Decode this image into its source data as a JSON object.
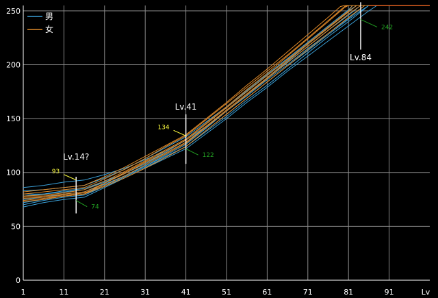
{
  "chart_data": {
    "type": "line",
    "xlabel": "Lv",
    "xlim": [
      1,
      101
    ],
    "ylim": [
      0,
      255
    ],
    "x_ticks": [
      1,
      11,
      21,
      31,
      41,
      51,
      61,
      71,
      81,
      91
    ],
    "y_ticks": [
      0,
      50,
      100,
      150,
      200,
      250
    ],
    "grid": true,
    "legend_position": "top-left",
    "colors": {
      "male": "#3aa0d8",
      "female": "#e08a2a",
      "cap": "#e06020",
      "grid": "#8a8a8a",
      "axis": "#ffffff",
      "green": "#22a022",
      "yellow": "#ffff40"
    },
    "legend": [
      {
        "label": "男",
        "color": "#3aa0d8"
      },
      {
        "label": "女",
        "color": "#e08a2a"
      }
    ],
    "series": [
      {
        "group": "male",
        "values": [
          [
            1,
            80
          ],
          [
            6,
            80
          ],
          [
            11,
            83
          ],
          [
            16,
            85
          ],
          [
            21,
            92
          ],
          [
            26,
            99
          ],
          [
            31,
            108
          ],
          [
            36,
            118
          ],
          [
            41,
            128
          ],
          [
            46,
            142
          ],
          [
            51,
            157
          ],
          [
            56,
            172
          ],
          [
            61,
            187
          ],
          [
            66,
            202
          ],
          [
            71,
            217
          ],
          [
            76,
            232
          ],
          [
            81,
            246
          ],
          [
            84,
            255
          ],
          [
            101,
            255
          ]
        ]
      },
      {
        "group": "male",
        "values": [
          [
            1,
            72
          ],
          [
            6,
            75
          ],
          [
            11,
            78
          ],
          [
            16,
            80
          ],
          [
            21,
            88
          ],
          [
            26,
            97
          ],
          [
            31,
            106
          ],
          [
            36,
            116
          ],
          [
            41,
            126
          ],
          [
            46,
            141
          ],
          [
            51,
            157
          ],
          [
            56,
            172
          ],
          [
            61,
            188
          ],
          [
            66,
            203
          ],
          [
            71,
            219
          ],
          [
            76,
            234
          ],
          [
            81,
            249
          ],
          [
            83,
            255
          ],
          [
            101,
            255
          ]
        ]
      },
      {
        "group": "male",
        "values": [
          [
            1,
            86
          ],
          [
            6,
            88
          ],
          [
            11,
            91
          ],
          [
            16,
            93
          ],
          [
            21,
            98
          ],
          [
            26,
            104
          ],
          [
            31,
            112
          ],
          [
            36,
            120
          ],
          [
            41,
            130
          ],
          [
            46,
            143
          ],
          [
            51,
            157
          ],
          [
            56,
            171
          ],
          [
            61,
            186
          ],
          [
            66,
            200
          ],
          [
            71,
            215
          ],
          [
            76,
            229
          ],
          [
            81,
            243
          ],
          [
            85,
            255
          ],
          [
            101,
            255
          ]
        ]
      },
      {
        "group": "male",
        "values": [
          [
            1,
            68
          ],
          [
            6,
            72
          ],
          [
            11,
            75
          ],
          [
            16,
            77
          ],
          [
            21,
            86
          ],
          [
            26,
            95
          ],
          [
            31,
            104
          ],
          [
            36,
            113
          ],
          [
            41,
            122
          ],
          [
            46,
            136
          ],
          [
            51,
            150
          ],
          [
            56,
            165
          ],
          [
            61,
            179
          ],
          [
            66,
            194
          ],
          [
            71,
            208
          ],
          [
            76,
            222
          ],
          [
            81,
            236
          ],
          [
            86,
            250
          ],
          [
            88,
            255
          ],
          [
            101,
            255
          ]
        ]
      },
      {
        "group": "male",
        "values": [
          [
            1,
            78
          ],
          [
            6,
            80
          ],
          [
            11,
            82
          ],
          [
            16,
            84
          ],
          [
            21,
            91
          ],
          [
            26,
            99
          ],
          [
            31,
            109
          ],
          [
            36,
            119
          ],
          [
            41,
            130
          ],
          [
            46,
            145
          ],
          [
            51,
            160
          ],
          [
            56,
            175
          ],
          [
            61,
            190
          ],
          [
            66,
            205
          ],
          [
            71,
            220
          ],
          [
            76,
            235
          ],
          [
            81,
            250
          ],
          [
            83,
            255
          ],
          [
            101,
            255
          ]
        ]
      },
      {
        "group": "male",
        "values": [
          [
            1,
            75
          ],
          [
            6,
            77
          ],
          [
            11,
            80
          ],
          [
            16,
            82
          ],
          [
            21,
            89
          ],
          [
            26,
            97
          ],
          [
            31,
            106
          ],
          [
            36,
            115
          ],
          [
            41,
            124
          ],
          [
            46,
            138
          ],
          [
            51,
            152
          ],
          [
            56,
            167
          ],
          [
            61,
            181
          ],
          [
            66,
            196
          ],
          [
            71,
            211
          ],
          [
            76,
            226
          ],
          [
            81,
            240
          ],
          [
            85,
            252
          ],
          [
            86,
            255
          ],
          [
            101,
            255
          ]
        ]
      },
      {
        "group": "male",
        "values": [
          [
            1,
            83
          ],
          [
            6,
            84
          ],
          [
            11,
            86
          ],
          [
            16,
            88
          ],
          [
            21,
            95
          ],
          [
            26,
            103
          ],
          [
            31,
            113
          ],
          [
            36,
            123
          ],
          [
            41,
            133
          ],
          [
            46,
            147
          ],
          [
            51,
            161
          ],
          [
            56,
            176
          ],
          [
            61,
            191
          ],
          [
            66,
            206
          ],
          [
            71,
            221
          ],
          [
            76,
            236
          ],
          [
            81,
            251
          ],
          [
            82,
            255
          ],
          [
            101,
            255
          ]
        ]
      },
      {
        "group": "male",
        "values": [
          [
            1,
            70
          ],
          [
            6,
            74
          ],
          [
            11,
            77
          ],
          [
            16,
            79
          ],
          [
            21,
            87
          ],
          [
            26,
            96
          ],
          [
            31,
            105
          ],
          [
            36,
            114
          ],
          [
            41,
            124
          ],
          [
            46,
            139
          ],
          [
            51,
            154
          ],
          [
            56,
            169
          ],
          [
            61,
            184
          ],
          [
            66,
            199
          ],
          [
            71,
            213
          ],
          [
            76,
            228
          ],
          [
            81,
            242
          ],
          [
            84,
            250
          ],
          [
            86,
            255
          ],
          [
            101,
            255
          ]
        ]
      },
      {
        "group": "female",
        "values": [
          [
            1,
            78
          ],
          [
            6,
            79
          ],
          [
            11,
            81
          ],
          [
            16,
            84
          ],
          [
            21,
            92
          ],
          [
            26,
            101
          ],
          [
            31,
            111
          ],
          [
            36,
            121
          ],
          [
            41,
            131
          ],
          [
            46,
            146
          ],
          [
            51,
            161
          ],
          [
            56,
            177
          ],
          [
            61,
            192
          ],
          [
            66,
            208
          ],
          [
            71,
            224
          ],
          [
            76,
            240
          ],
          [
            80,
            253
          ],
          [
            81,
            255
          ],
          [
            101,
            255
          ]
        ]
      },
      {
        "group": "female",
        "values": [
          [
            1,
            73
          ],
          [
            6,
            75
          ],
          [
            11,
            78
          ],
          [
            16,
            80
          ],
          [
            21,
            90
          ],
          [
            26,
            100
          ],
          [
            31,
            110
          ],
          [
            36,
            120
          ],
          [
            41,
            130
          ],
          [
            46,
            145
          ],
          [
            51,
            160
          ],
          [
            56,
            175
          ],
          [
            61,
            190
          ],
          [
            66,
            205
          ],
          [
            71,
            220
          ],
          [
            76,
            235
          ],
          [
            81,
            250
          ],
          [
            82,
            255
          ],
          [
            101,
            255
          ]
        ]
      },
      {
        "group": "female",
        "values": [
          [
            1,
            80
          ],
          [
            6,
            82
          ],
          [
            11,
            84
          ],
          [
            16,
            86
          ],
          [
            21,
            94
          ],
          [
            26,
            103
          ],
          [
            31,
            113
          ],
          [
            36,
            124
          ],
          [
            41,
            134
          ],
          [
            46,
            149
          ],
          [
            51,
            164
          ],
          [
            56,
            179
          ],
          [
            61,
            194
          ],
          [
            66,
            209
          ],
          [
            71,
            225
          ],
          [
            76,
            241
          ],
          [
            80,
            254
          ],
          [
            81,
            255
          ],
          [
            101,
            255
          ]
        ]
      },
      {
        "group": "female",
        "values": [
          [
            1,
            76
          ],
          [
            6,
            77
          ],
          [
            11,
            79
          ],
          [
            16,
            81
          ],
          [
            21,
            88
          ],
          [
            26,
            97
          ],
          [
            31,
            107
          ],
          [
            36,
            117
          ],
          [
            41,
            127
          ],
          [
            46,
            142
          ],
          [
            51,
            157
          ],
          [
            56,
            172
          ],
          [
            61,
            187
          ],
          [
            66,
            202
          ],
          [
            71,
            217
          ],
          [
            76,
            232
          ],
          [
            81,
            247
          ],
          [
            84,
            255
          ],
          [
            101,
            255
          ]
        ]
      },
      {
        "group": "female",
        "values": [
          [
            1,
            82
          ],
          [
            6,
            84
          ],
          [
            11,
            86
          ],
          [
            16,
            88
          ],
          [
            21,
            96
          ],
          [
            26,
            105
          ],
          [
            31,
            115
          ],
          [
            36,
            125
          ],
          [
            41,
            135
          ],
          [
            46,
            150
          ],
          [
            51,
            165
          ],
          [
            56,
            181
          ],
          [
            61,
            196
          ],
          [
            66,
            212
          ],
          [
            71,
            228
          ],
          [
            76,
            244
          ],
          [
            79,
            254
          ],
          [
            80,
            255
          ],
          [
            101,
            255
          ]
        ]
      },
      {
        "group": "female",
        "values": [
          [
            1,
            74
          ],
          [
            6,
            76
          ],
          [
            11,
            78
          ],
          [
            16,
            80
          ],
          [
            21,
            87
          ],
          [
            26,
            95
          ],
          [
            31,
            104
          ],
          [
            36,
            114
          ],
          [
            41,
            124
          ],
          [
            46,
            139
          ],
          [
            51,
            154
          ],
          [
            56,
            169
          ],
          [
            61,
            184
          ],
          [
            66,
            199
          ],
          [
            71,
            214
          ],
          [
            76,
            229
          ],
          [
            81,
            244
          ],
          [
            85,
            255
          ],
          [
            101,
            255
          ]
        ]
      },
      {
        "group": "female",
        "values": [
          [
            1,
            77
          ],
          [
            6,
            78
          ],
          [
            11,
            80
          ],
          [
            16,
            82
          ],
          [
            21,
            90
          ],
          [
            26,
            99
          ],
          [
            31,
            109
          ],
          [
            36,
            118
          ],
          [
            41,
            128
          ],
          [
            46,
            143
          ],
          [
            51,
            158
          ],
          [
            56,
            173
          ],
          [
            61,
            188
          ],
          [
            66,
            204
          ],
          [
            71,
            219
          ],
          [
            76,
            234
          ],
          [
            81,
            249
          ],
          [
            83,
            255
          ],
          [
            101,
            255
          ]
        ]
      }
    ],
    "annotations": [
      {
        "label": "Lv.14?",
        "x": 14,
        "y_low": 62,
        "y_high": 96,
        "high_value": "93",
        "low_value": "74"
      },
      {
        "label": "Lv.41",
        "x": 41,
        "y_low": 108,
        "y_high": 154,
        "high_value": "134",
        "low_value": "122"
      },
      {
        "label": "Lv.84",
        "x": 84,
        "y_low": 214,
        "y_high": 258,
        "low_value": "242"
      }
    ]
  }
}
